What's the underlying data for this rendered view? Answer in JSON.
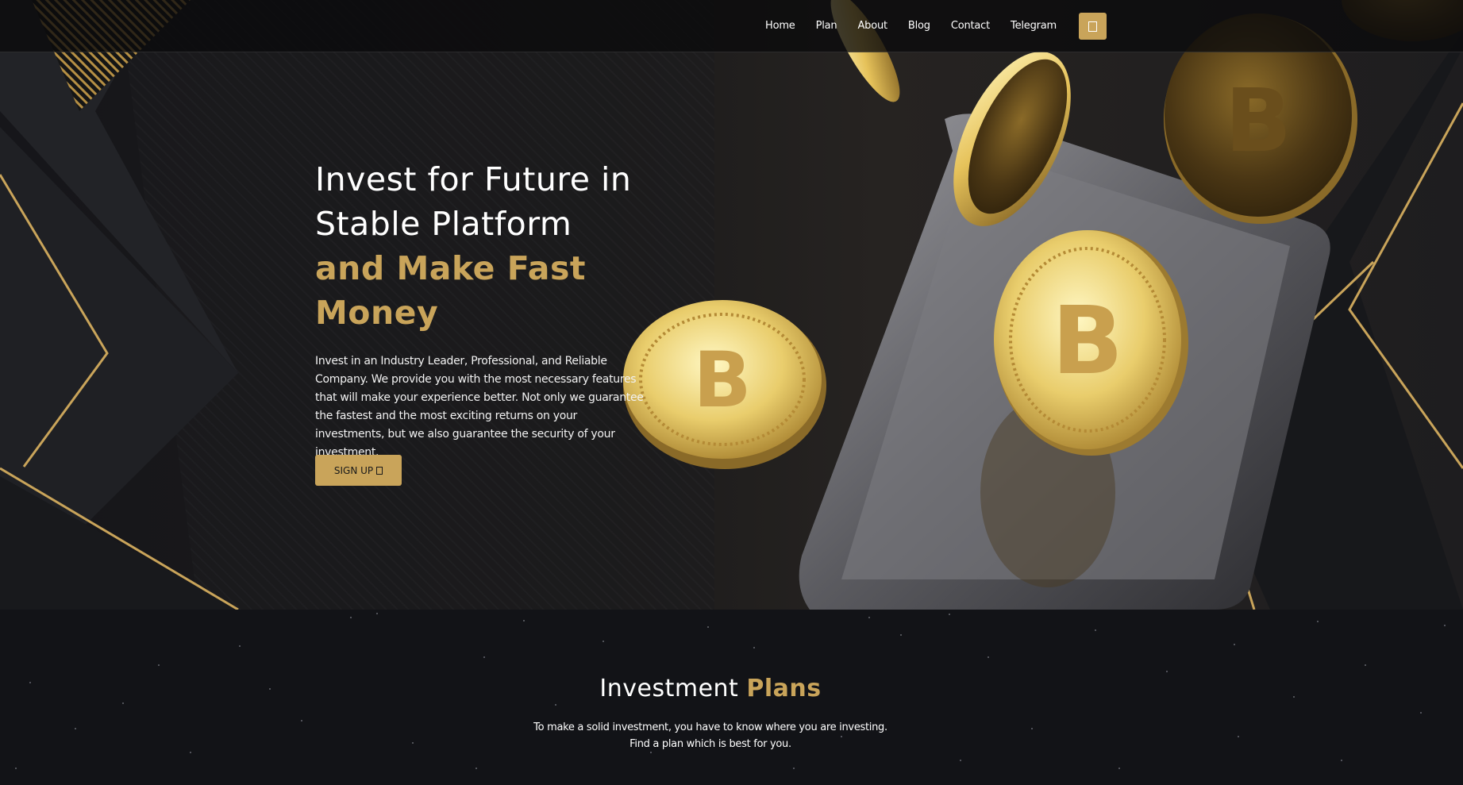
{
  "nav": {
    "links": [
      "Home",
      "Plan",
      "About",
      "Blog",
      "Contact",
      "Telegram"
    ],
    "action_icon": "menu-icon"
  },
  "hero": {
    "title_line1": "Invest for Future in",
    "title_line2": "Stable Platform",
    "title_accent_line1": "and Make Fast",
    "title_accent_line2": "Money",
    "description": "Invest in an Industry Leader, Professional, and Reliable Company. We provide you with the most necessary features that will make your experience better. Not only we guarantee the fastest and the most exciting returns on your investments, but we also guarantee the security of your investment.",
    "cta_label": "SIGN UP",
    "cta_icon": "arrow-icon",
    "coin_letter": "B"
  },
  "plans": {
    "heading_main": "Investment",
    "heading_accent": "Plans",
    "subtitle": "To make a solid investment, you have to know where you are investing. Find a plan which is best for you."
  },
  "colors": {
    "accent": "#c9a45a",
    "background": "#121317"
  }
}
